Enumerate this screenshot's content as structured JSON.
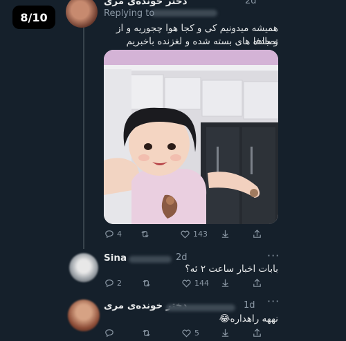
{
  "counter": "8/10",
  "tweet1": {
    "name": "دختر خونده‌ی مری",
    "time": "2d",
    "replying": "Replying to",
    "line1": "همیشه میدونیم کی و کجا هوا چجوریه و از تصادفا",
    "line2": "و جاده های بسته شده و لغزنده باخبریم",
    "replies": "4",
    "likes": "143"
  },
  "tweet2": {
    "name": "Sina",
    "time": "2d",
    "text": "بابات اخبار ساعت ۲ ئه؟",
    "replies": "2",
    "likes": "144"
  },
  "tweet3": {
    "name": "دختر خونده‌ی مری",
    "time": "1d",
    "text": "نهھه راهداره😂",
    "likes": "5"
  },
  "colors": {
    "background": "#15202b",
    "muted": "#8b98a5",
    "text": "#e7e9ea"
  },
  "icons": [
    "reply-icon",
    "retweet-icon",
    "like-icon",
    "download-icon",
    "share-icon",
    "more-icon"
  ]
}
